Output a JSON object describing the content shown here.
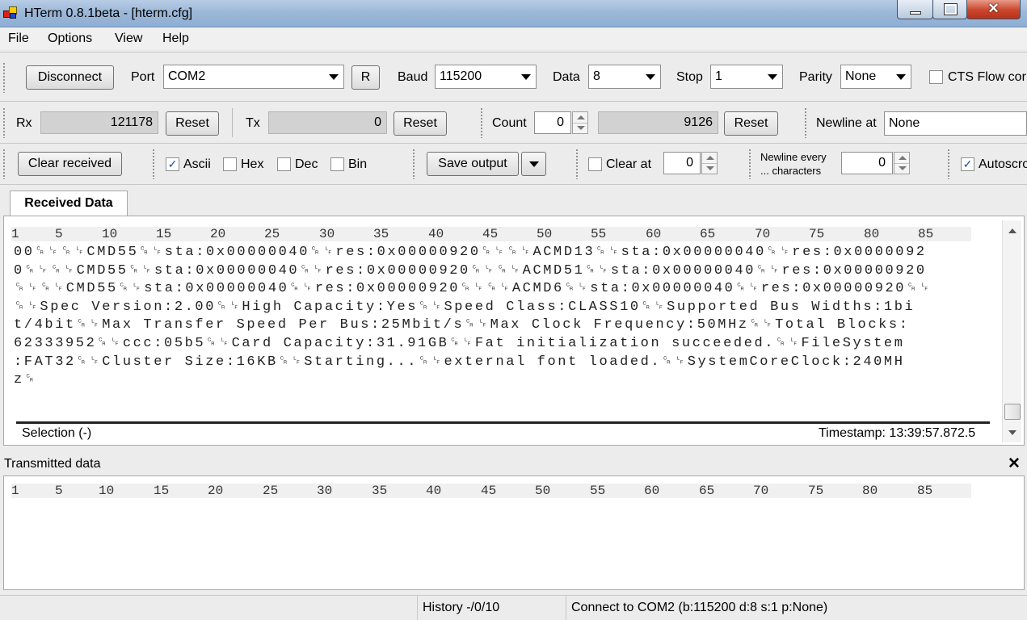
{
  "window": {
    "title": "HTerm 0.8.1beta - [hterm.cfg]",
    "controls": {
      "minimize": "—",
      "maximize": "□",
      "close": "✕"
    }
  },
  "menu": [
    "File",
    "Options",
    "View",
    "Help"
  ],
  "connection": {
    "disconnect_label": "Disconnect",
    "port_label": "Port",
    "port_value": "COM2",
    "refresh_label": "R",
    "baud_label": "Baud",
    "baud_value": "115200",
    "data_label": "Data",
    "data_value": "8",
    "stop_label": "Stop",
    "stop_value": "1",
    "parity_label": "Parity",
    "parity_value": "None",
    "cts_label": "CTS Flow cor",
    "cts_checked": false
  },
  "counters": {
    "rx_label": "Rx",
    "rx_value": "121178",
    "rx_reset": "Reset",
    "tx_label": "Tx",
    "tx_value": "0",
    "tx_reset": "Reset",
    "count_label": "Count",
    "count_value": "0",
    "count_total": "9126",
    "count_reset": "Reset",
    "newline_at_label": "Newline at",
    "newline_at_value": "None"
  },
  "display_options": {
    "clear_received_label": "Clear received",
    "ascii_label": "Ascii",
    "ascii_checked": true,
    "hex_label": "Hex",
    "hex_checked": false,
    "dec_label": "Dec",
    "dec_checked": false,
    "bin_label": "Bin",
    "bin_checked": false,
    "save_output_label": "Save output",
    "clear_at_label": "Clear at",
    "clear_at_checked": false,
    "clear_at_value": "0",
    "newline_every_label_1": "Newline every",
    "newline_every_label_2": "... characters",
    "newline_every_value": "0",
    "autoscroll_label": "Autoscro",
    "autoscroll_checked": true
  },
  "received": {
    "tab_label": "Received Data",
    "ruler": [
      "1",
      "5",
      "10",
      "15",
      "20",
      "25",
      "30",
      "35",
      "40",
      "45",
      "50",
      "55",
      "60",
      "65",
      "70",
      "75",
      "80",
      "85"
    ],
    "lines": [
      "00␍␊␍␊CMD55␍␊sta:0x00000040␍␊res:0x00000920␍␊␍␊ACMD13␍␊sta:0x00000040␍␊res:0x0000092",
      "0␍␊␍␊CMD55␍␊sta:0x00000040␍␊res:0x00000920␍␊␍␊ACMD51␍␊sta:0x00000040␍␊res:0x00000920",
      "␍␊␍␊CMD55␍␊sta:0x00000040␍␊res:0x00000920␍␊␍␊ACMD6␍␊sta:0x00000040␍␊res:0x00000920␍␊",
      "␍␊Spec Version:2.00␍␊High Capacity:Yes␍␊Speed Class:CLASS10␍␊Supported Bus Widths:1bi",
      "t/4bit␍␊Max Transfer Speed Per Bus:25Mbit/s␍␊Max Clock Frequency:50MHz␍␊Total Blocks:",
      "62333952␍␊ccc:05b5␍␊Card Capacity:31.91GB␍␊Fat initialization succeeded.␍␊FileSystem",
      ":FAT32␍␊Cluster Size:16KB␍␊Starting...␍␊external font loaded.␍␊SystemCoreClock:240MH",
      "z␍"
    ],
    "selection_label": "Selection (-)",
    "timestamp_label": "Timestamp: 13:39:57.872.5"
  },
  "transmitted": {
    "title": "Transmitted data",
    "close": "✕",
    "ruler": [
      "1",
      "5",
      "10",
      "15",
      "20",
      "25",
      "30",
      "35",
      "40",
      "45",
      "50",
      "55",
      "60",
      "65",
      "70",
      "75",
      "80",
      "85"
    ]
  },
  "status": {
    "history": "History -/0/10",
    "connection": "Connect to COM2 (b:115200 d:8 s:1 p:None)"
  }
}
